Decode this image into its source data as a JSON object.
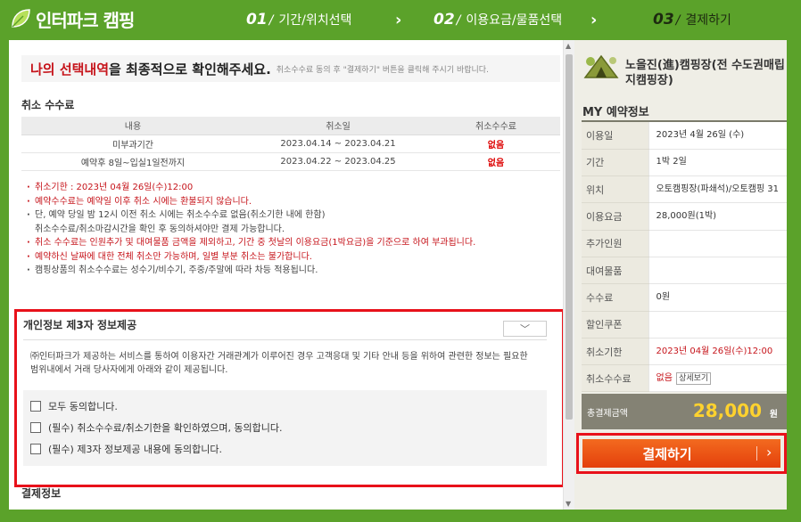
{
  "header": {
    "logo": "인터파크 캠핑",
    "steps": [
      {
        "num": "01",
        "label": "기간/위치선택"
      },
      {
        "num": "02",
        "label": "이용요금/물품선택"
      },
      {
        "num": "03",
        "label": "결제하기"
      }
    ],
    "arrow": "›"
  },
  "notice": {
    "red": "나의 선택내역",
    "main": "을 최종적으로 확인해주세요.",
    "sub": "취소수수료 동의 후 \"결제하기\" 버튼을 클릭해 주시기 바랍니다."
  },
  "cancel_section": {
    "title": "취소 수수료",
    "headers": [
      "내용",
      "취소일",
      "취소수수료"
    ],
    "rows": [
      [
        "미부과기간",
        "2023.04.14 ~ 2023.04.21",
        "없음"
      ],
      [
        "예약후 8일~입실1일전까지",
        "2023.04.22 ~ 2023.04.25",
        "없음"
      ]
    ],
    "rules": [
      "취소기한 : 2023년 04월 26일(수)12:00",
      "예약수수료는 예약일 이후 취소 시에는 환불되지 않습니다.",
      "단, 예약 당일 밤 12시 이전 취소 시에는 취소수수료 없음(취소기한 내에 한함)",
      "취소수수료/취소마감시간을 확인 후 동의하셔야만 결제 가능합니다.",
      "취소 수수료는 인원추가 및 대여물품 금액을 제외하고, 기간 중 첫날의 이용요금(1박요금)을 기준으로 하여 부과됩니다.",
      "예약하신 날짜에 대한 전체 취소만 가능하며, 일별 부분 취소는 불가합니다.",
      "캠핑상품의 취소수수료는 성수기/비수기, 주중/주말에 따라 차등 적용됩니다."
    ]
  },
  "privacy": {
    "title": "개인정보 제3자 정보제공",
    "toggle_icon": "chevron-down",
    "toggle_glyph": "﹀",
    "body": "㈜인터파크가 제공하는 서비스를 통하여 이용자간 거래관계가 이루어진 경우 고객응대 및 기타 안내 등을 위하여 관련한 정보는 필요한 범위내에서 거래 당사자에게 아래와 같이 제공됩니다.",
    "agreements": [
      "모두 동의합니다.",
      "(필수) 취소수수료/취소기한을 확인하였으며, 동의합니다.",
      "(필수) 제3자 정보제공 내용에 동의합니다."
    ]
  },
  "payment_section": {
    "title": "결제정보"
  },
  "right": {
    "camp_name": "노을진(進)캠핑장(전 수도권매립지캠핑장)",
    "my_title": "MY 예약정보",
    "info": [
      {
        "label": "이용일",
        "value": "2023년 4월 26일 (수)"
      },
      {
        "label": "기간",
        "value": "1박 2일"
      },
      {
        "label": "위치",
        "value": "오토캠핑장(파쇄석)/오토캠핑 31"
      },
      {
        "label": "이용요금",
        "value": "28,000원(1박)"
      },
      {
        "label": "추가인원",
        "value": ""
      },
      {
        "label": "대여물품",
        "value": ""
      },
      {
        "label": "수수료",
        "value": "0원"
      },
      {
        "label": "할인쿠폰",
        "value": ""
      },
      {
        "label": "취소기한",
        "value": "2023년 04월 26일(수)12:00"
      },
      {
        "label": "취소수수료",
        "value": "없음",
        "button": "상세보기"
      }
    ],
    "total_label": "총결제금액",
    "total_value": "28,000",
    "total_unit": "원",
    "pay_button": "결제하기",
    "pay_arrow": "›"
  },
  "colors": {
    "brand_green": "#5ba22a",
    "accent_red": "#e8111a",
    "pay_orange": "#e4400c",
    "total_yellow": "#ffd22e"
  }
}
